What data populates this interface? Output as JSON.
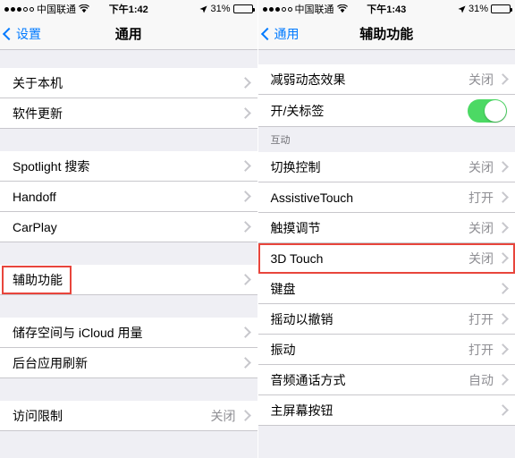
{
  "left": {
    "statusbar": {
      "carrier": "中国联通",
      "wifi_icon": "wifi-icon",
      "time": "下午1:42",
      "location_icon": "location-arrow-icon",
      "battery_percent": "31%",
      "battery_icon": "battery-icon"
    },
    "navbar": {
      "back_label": "设置",
      "back_icon": "chevron-left-icon",
      "title": "通用"
    },
    "groups": [
      {
        "rows": [
          {
            "label": "关于本机",
            "value": "",
            "accessory": "chevron-right-icon"
          },
          {
            "label": "软件更新",
            "value": "",
            "accessory": "chevron-right-icon"
          }
        ]
      },
      {
        "rows": [
          {
            "label": "Spotlight 搜索",
            "value": "",
            "accessory": "chevron-right-icon"
          },
          {
            "label": "Handoff",
            "value": "",
            "accessory": "chevron-right-icon"
          },
          {
            "label": "CarPlay",
            "value": "",
            "accessory": "chevron-right-icon"
          }
        ]
      },
      {
        "rows": [
          {
            "label": "辅助功能",
            "value": "",
            "accessory": "chevron-right-icon",
            "highlighted": true
          }
        ]
      },
      {
        "rows": [
          {
            "label": "储存空间与 iCloud 用量",
            "value": "",
            "accessory": "chevron-right-icon"
          },
          {
            "label": "后台应用刷新",
            "value": "",
            "accessory": "chevron-right-icon"
          }
        ]
      },
      {
        "rows": [
          {
            "label": "访问限制",
            "value": "关闭",
            "accessory": "chevron-right-icon"
          }
        ]
      }
    ]
  },
  "right": {
    "statusbar": {
      "carrier": "中国联通",
      "wifi_icon": "wifi-icon",
      "time": "下午1:43",
      "location_icon": "location-arrow-icon",
      "battery_percent": "31%",
      "battery_icon": "battery-icon"
    },
    "navbar": {
      "back_label": "通用",
      "back_icon": "chevron-left-icon",
      "title": "辅助功能"
    },
    "groups": [
      {
        "header": "",
        "rows": [
          {
            "label": "减弱动态效果",
            "value": "关闭",
            "accessory": "chevron-right-icon"
          },
          {
            "label": "开/关标签",
            "value": "",
            "accessory": "toggle-on"
          }
        ]
      },
      {
        "header": "互动",
        "rows": [
          {
            "label": "切换控制",
            "value": "关闭",
            "accessory": "chevron-right-icon"
          },
          {
            "label": "AssistiveTouch",
            "value": "打开",
            "accessory": "chevron-right-icon"
          },
          {
            "label": "触摸调节",
            "value": "关闭",
            "accessory": "chevron-right-icon"
          },
          {
            "label": "3D Touch",
            "value": "关闭",
            "accessory": "chevron-right-icon",
            "highlighted": true
          },
          {
            "label": "键盘",
            "value": "",
            "accessory": "chevron-right-icon"
          },
          {
            "label": "摇动以撤销",
            "value": "打开",
            "accessory": "chevron-right-icon"
          },
          {
            "label": "振动",
            "value": "打开",
            "accessory": "chevron-right-icon"
          },
          {
            "label": "音频通话方式",
            "value": "自动",
            "accessory": "chevron-right-icon"
          },
          {
            "label": "主屏幕按钮",
            "value": "",
            "accessory": "chevron-right-icon"
          }
        ]
      }
    ]
  },
  "colors": {
    "accent": "#007aff",
    "toggle_on": "#4cd964",
    "highlight": "#e8453c",
    "value_text": "#8e8e93",
    "group_bg": "#efeff4"
  }
}
